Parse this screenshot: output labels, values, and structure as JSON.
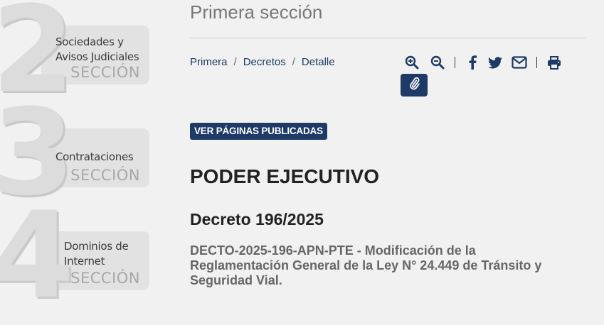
{
  "sections": [
    {
      "number": "2",
      "title_line1": "Sociedades y",
      "title_line2": "Avisos Judiciales",
      "label": "SECCIÓN"
    },
    {
      "number": "3",
      "title_line1": "Contrataciones",
      "title_line2": "",
      "label": "SECCIÓN"
    },
    {
      "number": "4",
      "title_line1": "Dominios de",
      "title_line2": "Internet",
      "label": "SECCIÓN"
    }
  ],
  "header": {
    "section_title": "Primera sección"
  },
  "breadcrumb": {
    "items": [
      "Primera",
      "Decretos",
      "Detalle"
    ],
    "separator": "/"
  },
  "toolbar": {
    "icons": [
      "zoom-in-icon",
      "zoom-out-icon",
      "facebook-icon",
      "twitter-icon",
      "email-icon",
      "print-icon",
      "attachment-icon"
    ],
    "separator": "|"
  },
  "published_button": "VER PÁGINAS PUBLICADAS",
  "heading": "PODER EJECUTIVO",
  "decree_title": "Decreto 196/2025",
  "summary": "DECTO-2025-196-APN-PTE - Modificación de la Reglamentación General de la Ley N° 24.449 de Tránsito y Seguridad Vial.",
  "colors": {
    "accent": "#1e3a66",
    "background": "#f1f1f1",
    "muted_text": "#666666"
  }
}
